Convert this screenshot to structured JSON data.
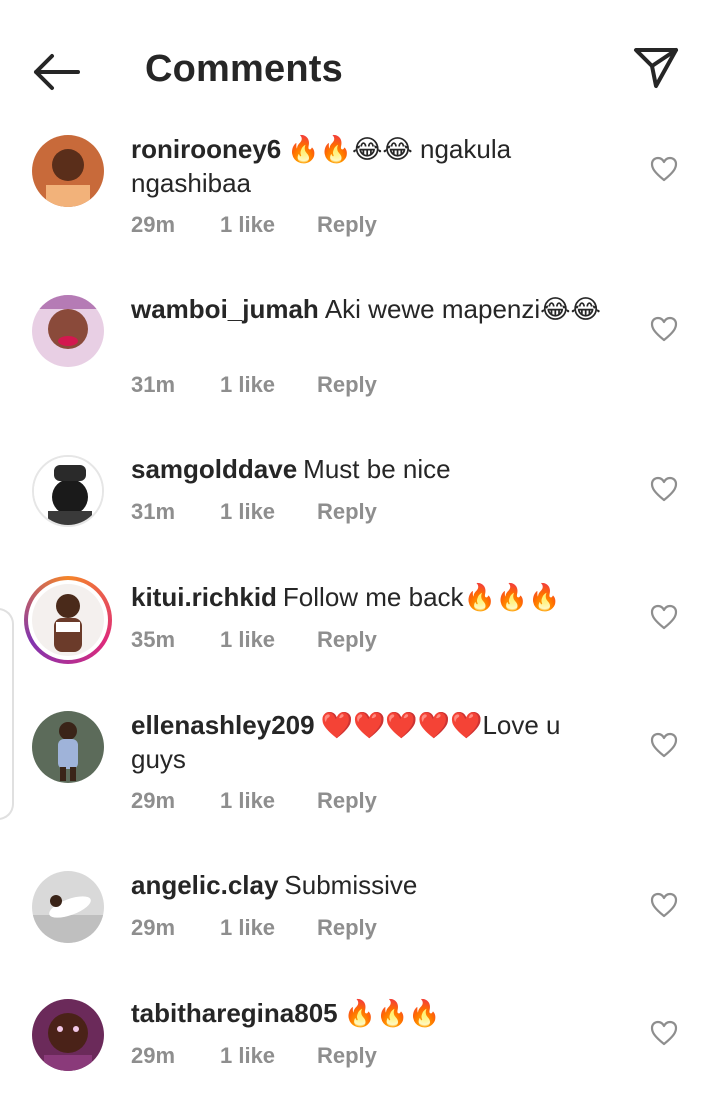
{
  "header": {
    "title": "Comments",
    "back_icon": "arrow-left-icon",
    "send_icon": "paper-plane-icon"
  },
  "comments": [
    {
      "username": "ronirooney6",
      "text": "🔥🔥😂😂 ngakula ngashibaa",
      "time": "29m",
      "likes": "1 like",
      "reply": "Reply"
    },
    {
      "username": "wamboi_jumah",
      "text": "Aki wewe mapenzi😂😂",
      "time": "31m",
      "likes": "1 like",
      "reply": "Reply"
    },
    {
      "username": "samgolddave",
      "text": "Must be nice",
      "time": "31m",
      "likes": "1 like",
      "reply": "Reply"
    },
    {
      "username": "kitui.richkid",
      "text": "Follow me back🔥🔥🔥",
      "time": "35m",
      "likes": "1 like",
      "reply": "Reply"
    },
    {
      "username": "ellenashley209",
      "text": "❤️❤️❤️❤️❤️Love u guys",
      "time": "29m",
      "likes": "1 like",
      "reply": "Reply"
    },
    {
      "username": "angelic.clay",
      "text": "Submissive",
      "time": "29m",
      "likes": "1 like",
      "reply": "Reply"
    },
    {
      "username": "tabitharegina805",
      "text": "🔥🔥🔥",
      "time": "29m",
      "likes": "1 like",
      "reply": "Reply"
    }
  ],
  "colors": {
    "text": "#262626",
    "secondary": "#8e8e8e",
    "story_ring": [
      "#f58529",
      "#dd2a7b",
      "#8134af"
    ]
  }
}
